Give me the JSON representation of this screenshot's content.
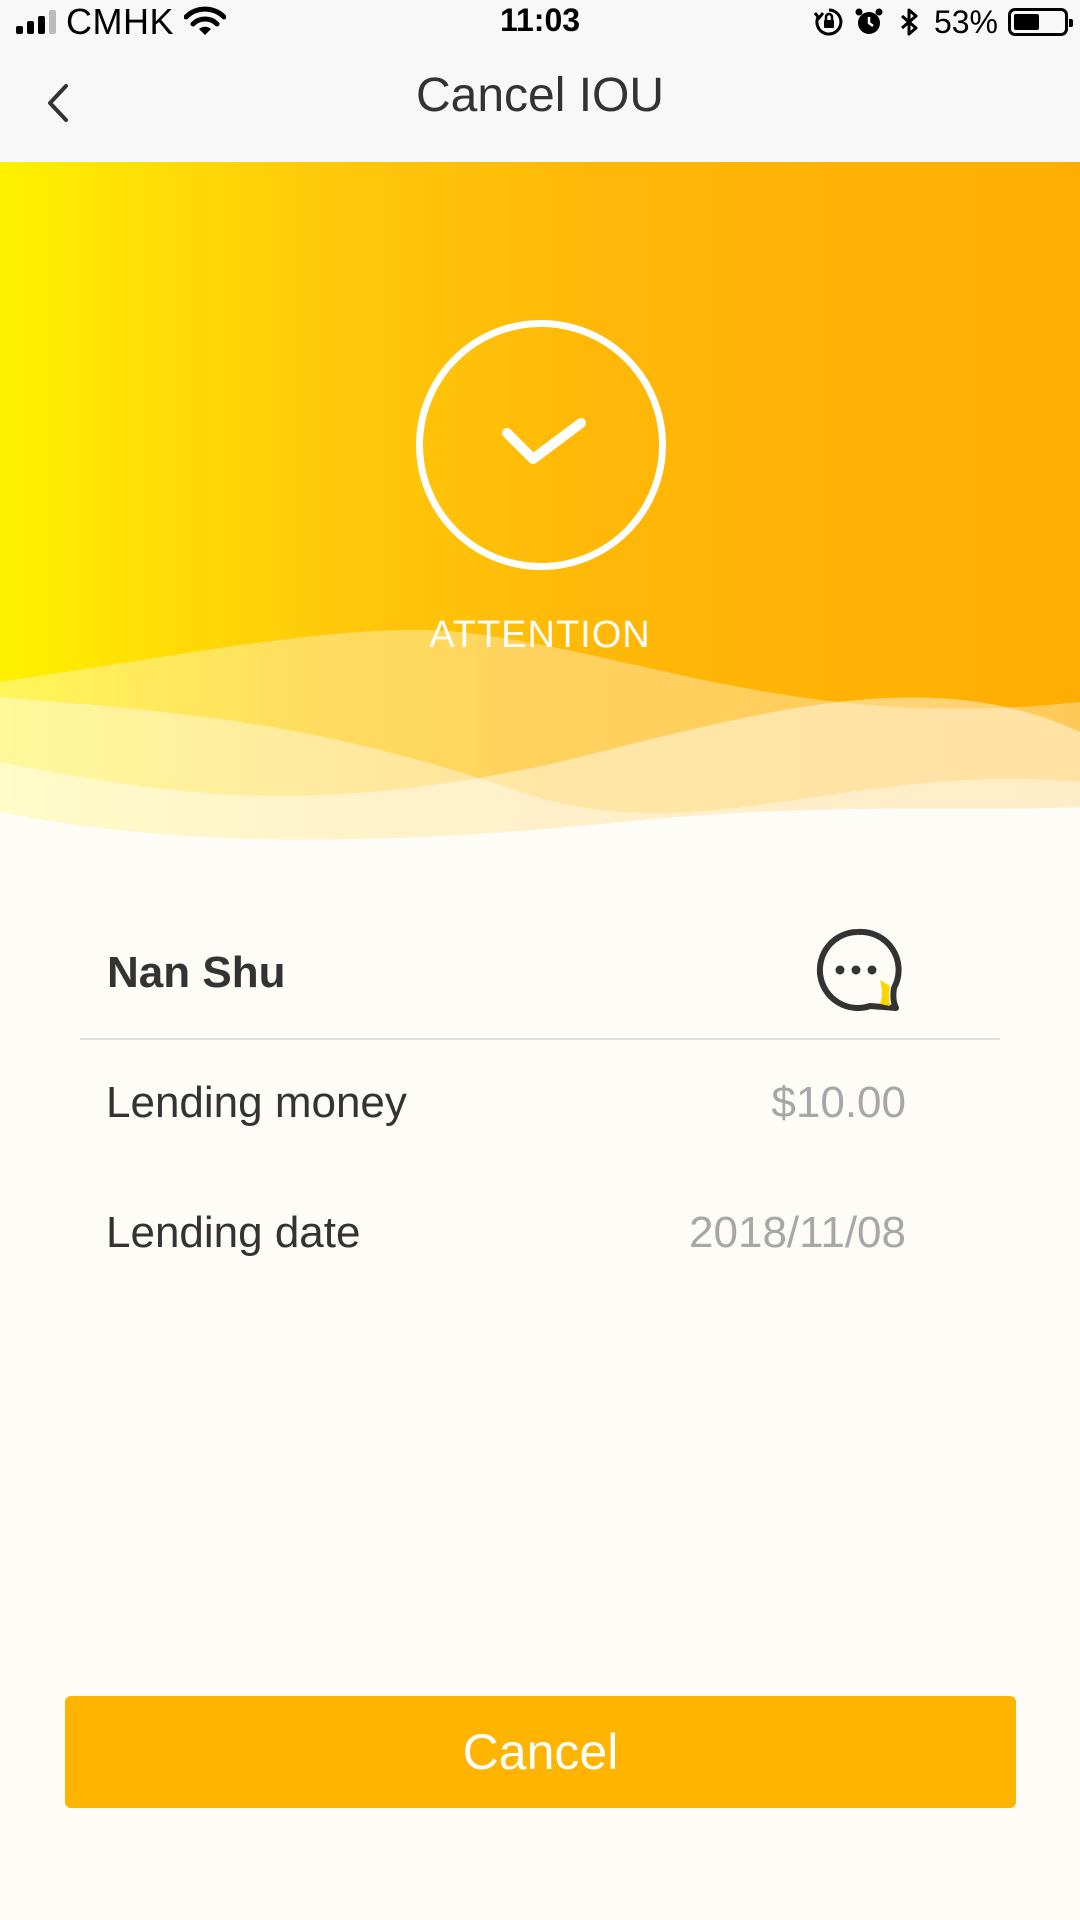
{
  "status_bar": {
    "carrier": "CMHK",
    "time": "11:03",
    "battery_percent": "53%",
    "battery_level": 0.53,
    "icons": [
      "signal-icon",
      "wifi-icon",
      "orientation-lock-icon",
      "alarm-icon",
      "bluetooth-icon",
      "battery-icon"
    ]
  },
  "nav": {
    "title": "Cancel IOU",
    "back_icon": "chevron-left-icon"
  },
  "hero": {
    "icon": "check-circle-icon",
    "status_text": "ATTENTION"
  },
  "iou": {
    "name": "Nan Shu",
    "chat_icon": "chat-bubble-icon",
    "fields": [
      {
        "label": "Lending money",
        "value": "$10.00"
      },
      {
        "label": "Lending date",
        "value": "2018/11/08"
      }
    ]
  },
  "actions": {
    "cancel_label": "Cancel"
  },
  "colors": {
    "accent": "#ffb400",
    "gradient_start": "#fff100",
    "gradient_end": "#ffad02",
    "background": "#fefcf7",
    "value_gray": "#a7a7a7"
  }
}
